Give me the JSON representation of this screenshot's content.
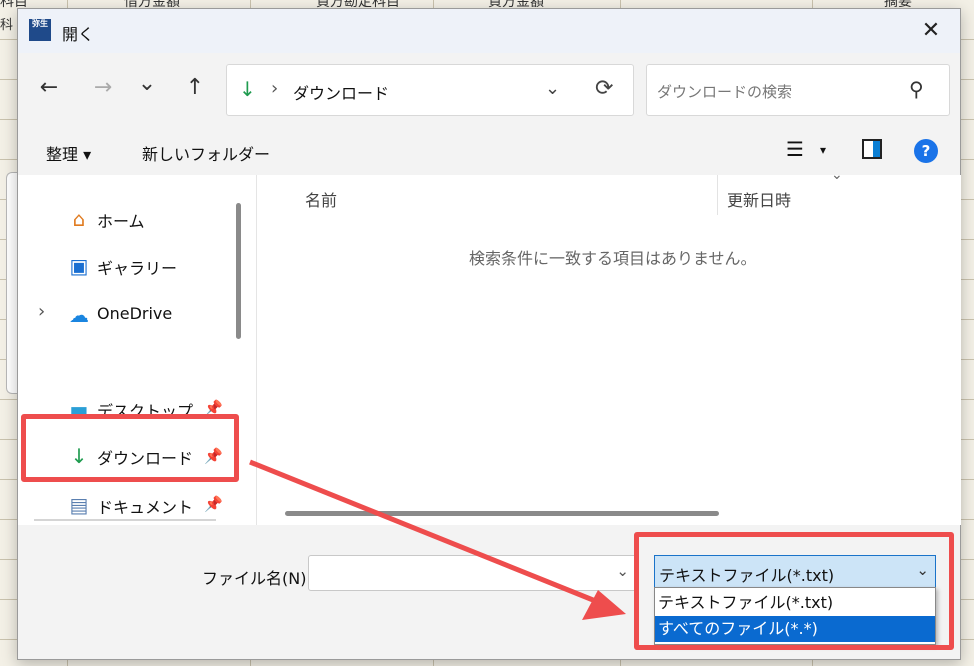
{
  "background": {
    "headers": [
      "科目",
      "借方金額",
      "貸方勘定科目",
      "貸方金額",
      "摘要"
    ],
    "left_label": "科"
  },
  "dialog": {
    "title": "開く",
    "app_icon": "弥生",
    "close_glyph": "✕"
  },
  "nav": {
    "back_glyph": "←",
    "forward_glyph": "→",
    "recent_glyph": "⌄",
    "up_glyph": "↑",
    "address_icon": "download-icon",
    "address_sep": "›",
    "address_text": "ダウンロード",
    "address_dropdown": "⌄",
    "refresh_glyph": "⟳",
    "search_placeholder": "ダウンロードの検索",
    "search_glyph": "⚲"
  },
  "toolbar": {
    "organize": "整理 ▾",
    "new_folder": "新しいフォルダー",
    "view_glyph": "☰",
    "view_dd": "▾",
    "help": "?"
  },
  "sidebar": {
    "items": [
      {
        "label": "ホーム",
        "icon": "home-icon"
      },
      {
        "label": "ギャラリー",
        "icon": "gallery-icon"
      },
      {
        "label": "OneDrive",
        "icon": "onedrive-icon"
      },
      {
        "label": "デスクトップ",
        "icon": "desktop-icon"
      },
      {
        "label": "ダウンロード",
        "icon": "download-icon"
      },
      {
        "label": "ドキュメント",
        "icon": "document-icon"
      }
    ],
    "expand_glyph": "›",
    "pin_glyph": "📌"
  },
  "content": {
    "col_name": "名前",
    "col_modified": "更新日時",
    "sort_glyph": "⌄",
    "empty_text": "検索条件に一致する項目はありません。"
  },
  "bottom": {
    "filename_label": "ファイル名(N):",
    "filename_value": "",
    "filetype_selected": "テキストファイル(*.txt)",
    "filetype_options": [
      "テキストファイル(*.txt)",
      "すべてのファイル(*.*)"
    ],
    "highlighted_option": "すべてのファイル(*.*)"
  },
  "colors": {
    "highlight": "#ee4d4d",
    "accent": "#0a6ad0",
    "download_green": "#1f9b4f"
  }
}
